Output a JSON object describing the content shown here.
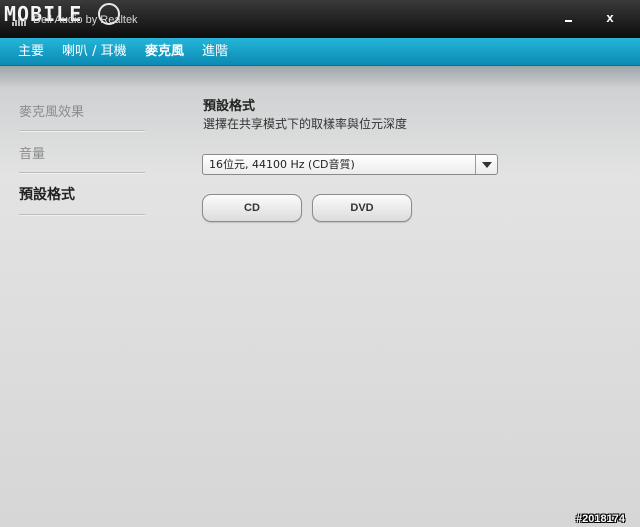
{
  "titlebar": {
    "logo": "MOBILE",
    "subtitle": "Dell Audio by Realtek",
    "minimize_label": "",
    "close_label": "x"
  },
  "tabs": [
    {
      "label": "主要",
      "active": false
    },
    {
      "label": "喇叭 / 耳機",
      "active": false
    },
    {
      "label": "麥克風",
      "active": true
    },
    {
      "label": "進階",
      "active": false
    }
  ],
  "sidebar": {
    "items": [
      {
        "label": "麥克風效果",
        "active": false
      },
      {
        "label": "音量",
        "active": false
      },
      {
        "label": "預設格式",
        "active": true
      }
    ]
  },
  "main": {
    "title": "預設格式",
    "description": "選擇在共享模式下的取樣率與位元深度",
    "format_select": {
      "value": "16位元, 44100 Hz (CD音質)"
    },
    "cd_button": "CD",
    "dvd_button": "DVD"
  },
  "watermark": "#2018174",
  "colors": {
    "tab_bar": "#13a0c8",
    "title_bar": "#1a1a1a",
    "content_bg": "#dcdcdc"
  }
}
